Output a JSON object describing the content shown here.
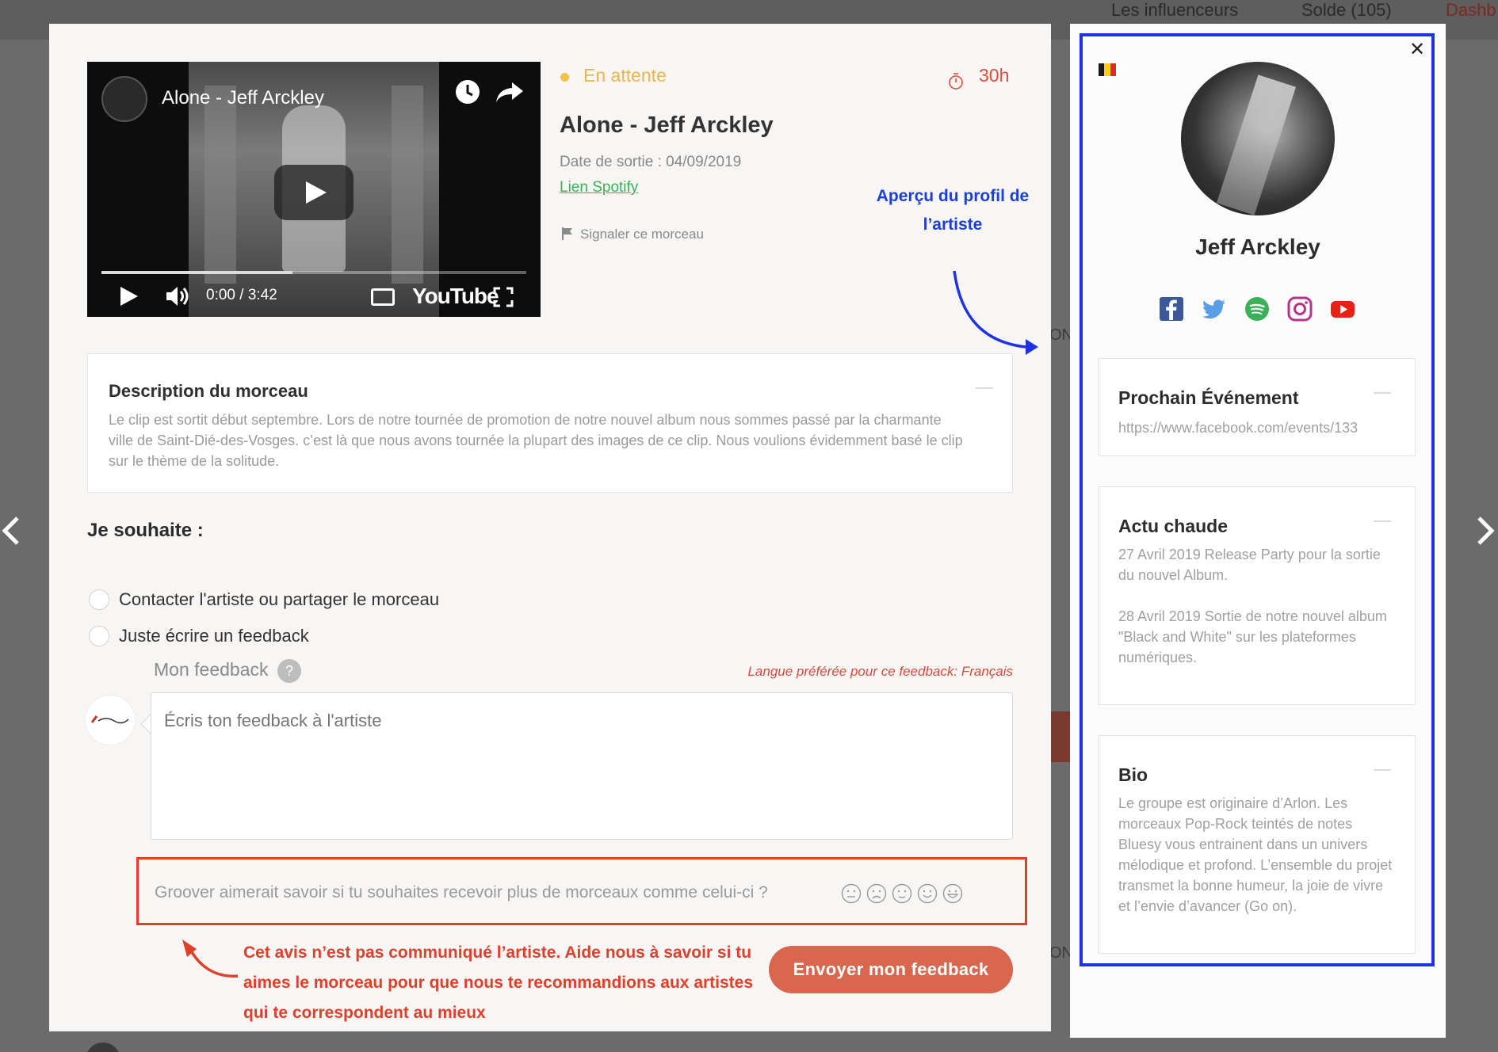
{
  "background": {
    "nav_items": [
      "Les influenceurs",
      "Solde (105)",
      "Dashb"
    ],
    "peek_texts": [
      "ON",
      "ON"
    ]
  },
  "video": {
    "title": "Alone - Jeff Arckley",
    "time": "0:00 / 3:42",
    "brand": "YouTube",
    "progress": 0.45
  },
  "track": {
    "status": "En attente",
    "timer": "30h",
    "title": "Alone - Jeff Arckley",
    "release_date": "Date de sortie : 04/09/2019",
    "spotify_link": "Lien Spotify",
    "report": "Signaler ce morceau"
  },
  "annotations": {
    "blue": "Aperçu du profil de l’artiste",
    "red": "Cet avis n’est pas communiqué l’artiste. Aide nous à savoir si tu aimes le morceau pour que nous te recommandions aux artistes qui te correspondent au mieux"
  },
  "description": {
    "title": "Description du morceau",
    "text": "Le clip est sortit début septembre. Lors de notre tournée de promotion de notre nouvel album nous sommes passé par la charmante ville de Saint-Dié-des-Vosges. c’est là que nous avons tournée la plupart des images de ce clip. Nous voulions évidemment basé le clip sur le thème de la solitude."
  },
  "wish": {
    "title": "Je souhaite :",
    "options": [
      "Contacter l'artiste ou partager le morceau",
      "Juste écrire un feedback"
    ]
  },
  "feedback": {
    "label": "Mon feedback",
    "help": "?",
    "language": "Langue préférée pour ce feedback: Français",
    "placeholder": "Écris ton feedback à l'artiste",
    "groover_question": "Groover aimerait savoir si tu souhaites recevoir plus de morceaux comme celui-ci ?",
    "send_button": "Envoyer mon feedback"
  },
  "artist": {
    "name": "Jeff Arckley",
    "country_flag": "belgium-flag",
    "socials": [
      "facebook-icon",
      "twitter-icon",
      "spotify-icon",
      "instagram-icon",
      "youtube-icon"
    ],
    "cards": [
      {
        "title": "Prochain Événement",
        "body": "https://www.facebook.com/events/133"
      },
      {
        "title": "Actu chaude",
        "body": "27 Avril 2019 Release Party pour la sortie du nouvel Album.\n\n28 Avril 2019 Sortie de notre nouvel album \"Black and White\" sur les plateformes numériques."
      },
      {
        "title": "Bio",
        "body": "Le groupe est originaire d’Arlon. Les morceaux Pop-Rock teintés de notes Bluesy vous entrainent dans un univers mélodique et profond.  L’ensemble du projet transmet la bonne humeur, la joie de vivre et l’envie d’avancer (Go on)."
      }
    ]
  },
  "colors": {
    "accent": "#d9674d",
    "annotation_red": "#e73b24",
    "annotation_blue": "#1f33e0",
    "status_yellow": "#e8b64c",
    "link_green": "#3bb05a"
  }
}
